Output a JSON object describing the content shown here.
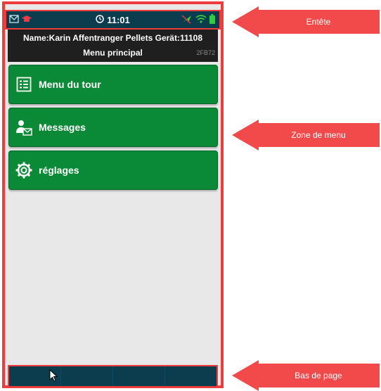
{
  "status": {
    "time": "11:01",
    "icons_left": [
      "mail-icon",
      "graduation-cap-icon"
    ],
    "icons_right": [
      "gps-off-icon",
      "wifi-icon",
      "battery-icon"
    ]
  },
  "title": {
    "name": "Name:Karin Affentranger Pellets Gerät:11108",
    "menu": "Menu principal",
    "code": "2FB72"
  },
  "menu": {
    "items": [
      {
        "label": "Menu du tour",
        "icon": "list-icon"
      },
      {
        "label": "Messages",
        "icon": "user-mail-icon"
      },
      {
        "label": "réglages",
        "icon": "gear-icon"
      }
    ]
  },
  "annotations": {
    "header": "Entête",
    "menu_zone": "Zone de menu",
    "footer": "Bas de page"
  },
  "colors": {
    "green": "#0a8a36",
    "header_bg": "#0b3d4e",
    "annotation_red": "#f24a4a"
  }
}
